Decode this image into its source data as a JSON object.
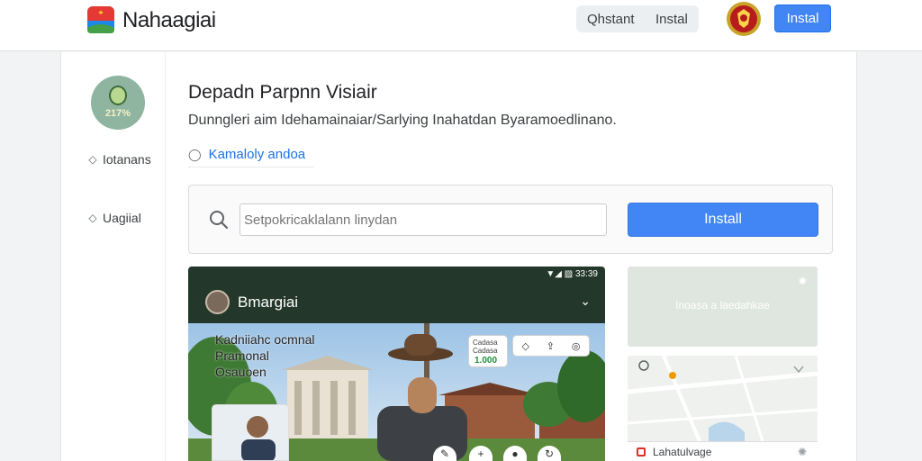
{
  "header": {
    "app_name": "Nahaagiai",
    "segments": [
      "Qhstant",
      "Instal"
    ],
    "install_label": "Instal",
    "logo_icon": "flag-logo-icon",
    "emblem_icon": "emblem-badge-icon"
  },
  "sidebar": {
    "badge_text": "217%",
    "items": [
      {
        "label": "Iotanans",
        "icon": "diamond-icon"
      },
      {
        "label": "Uagiial",
        "icon": "diamond-icon"
      }
    ]
  },
  "main": {
    "title": "Depadn Parpnn Visiair",
    "description": "Dunngleri aim Idehamainaiar/Sarlying Inahatdan Byaramoedlinano.",
    "link_label": "Kamaloly andoa"
  },
  "search": {
    "placeholder": "Setpokricaklalann linydan",
    "install_label": "Install"
  },
  "phone": {
    "status": "▼◢ ▨ 33:39",
    "title": "Bmargiai",
    "overlay_lines": [
      "Kadniiahc ocmnal",
      "Pramonal",
      "Osauoen"
    ],
    "badge_small": "Cadasa Cadasa",
    "badge_value": "1.000"
  },
  "right": {
    "map_label": "Inoasa a laedahkae",
    "map_footer": "Lahatulvage"
  },
  "colors": {
    "accent": "#4285f4",
    "link": "#1a73e8",
    "phone_bg": "#23382a"
  }
}
